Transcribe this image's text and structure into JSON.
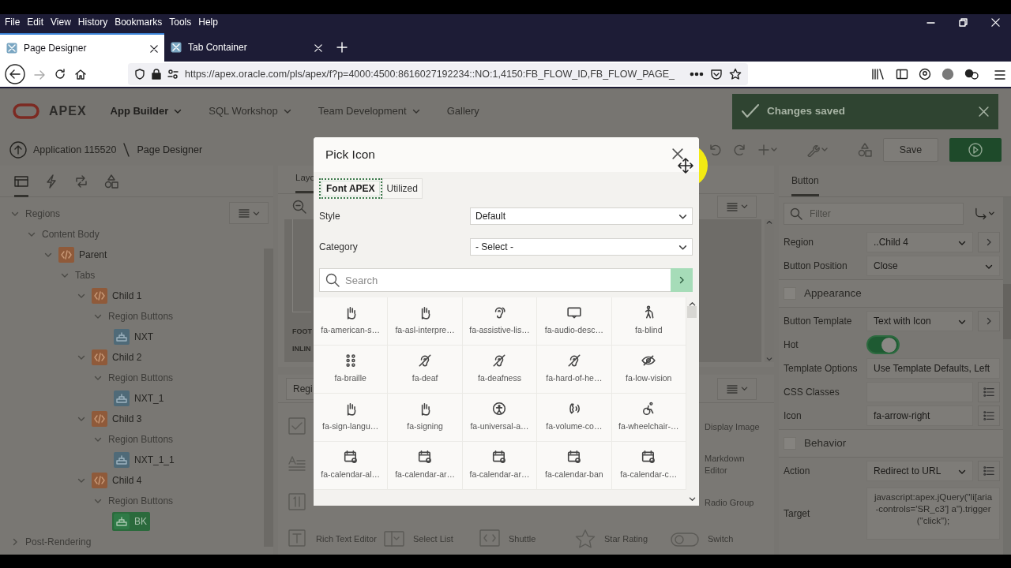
{
  "browser": {
    "menu": [
      "File",
      "Edit",
      "View",
      "History",
      "Bookmarks",
      "Tools",
      "Help"
    ],
    "tabs": [
      {
        "title": "Page Designer",
        "selected": true
      },
      {
        "title": "Tab Container",
        "selected": false
      }
    ],
    "url": "https://apex.oracle.com/pls/apex/f?p=4000:4500:8616027192234::NO:1,4150:FB_FLOW_ID,FB_FLOW_PAGE_"
  },
  "app": {
    "logo": "APEX",
    "nav": [
      {
        "label": "App Builder",
        "selected": true,
        "menu": true
      },
      {
        "label": "SQL Workshop",
        "selected": false,
        "menu": true
      },
      {
        "label": "Team Development",
        "selected": false,
        "menu": true
      },
      {
        "label": "Gallery",
        "selected": false,
        "menu": false
      }
    ],
    "toast": "Changes saved",
    "breadcrumb": [
      "Application 115520",
      "Page Designer"
    ],
    "save": "Save"
  },
  "left": {
    "tabs": [
      {
        "kind": "grid",
        "selected": true
      },
      {
        "kind": "bolt",
        "selected": false
      },
      {
        "kind": "loop",
        "selected": false
      },
      {
        "kind": "shapes",
        "selected": false
      }
    ],
    "tree": [
      {
        "label": "Regions",
        "kind": "group",
        "expanded": true,
        "selected": false,
        "children": [
          {
            "label": "Content Body",
            "kind": "group",
            "expanded": true,
            "selected": false,
            "children": [
              {
                "label": "Parent",
                "kind": "region",
                "expanded": true,
                "selected": false,
                "children": [
                  {
                    "label": "Tabs",
                    "kind": "group",
                    "expanded": true,
                    "selected": false,
                    "children": [
                      {
                        "label": "Child 1",
                        "kind": "region",
                        "expanded": true,
                        "selected": false,
                        "children": [
                          {
                            "label": "Region Buttons",
                            "kind": "group",
                            "expanded": true,
                            "selected": false,
                            "children": [
                              {
                                "label": "NXT",
                                "kind": "button",
                                "selected": false
                              }
                            ]
                          }
                        ]
                      },
                      {
                        "label": "Child 2",
                        "kind": "region",
                        "expanded": true,
                        "selected": false,
                        "children": [
                          {
                            "label": "Region Buttons",
                            "kind": "group",
                            "expanded": true,
                            "selected": false,
                            "children": [
                              {
                                "label": "NXT_1",
                                "kind": "button",
                                "selected": false
                              }
                            ]
                          }
                        ]
                      },
                      {
                        "label": "Child 3",
                        "kind": "region",
                        "expanded": true,
                        "selected": false,
                        "children": [
                          {
                            "label": "Region Buttons",
                            "kind": "group",
                            "expanded": true,
                            "selected": false,
                            "children": [
                              {
                                "label": "NXT_1_1",
                                "kind": "button",
                                "selected": false
                              }
                            ]
                          }
                        ]
                      },
                      {
                        "label": "Child 4",
                        "kind": "region",
                        "expanded": true,
                        "selected": false,
                        "children": [
                          {
                            "label": "Region Buttons",
                            "kind": "group",
                            "expanded": true,
                            "selected": false,
                            "children": [
                              {
                                "label": "BK",
                                "kind": "button",
                                "selected": true
                              }
                            ]
                          }
                        ]
                      }
                    ]
                  }
                ]
              }
            ]
          }
        ]
      },
      {
        "label": "Post-Rendering",
        "kind": "group",
        "expanded": false,
        "selected": false
      }
    ]
  },
  "center": {
    "tab": "Layo",
    "canvas_labels": [
      "FOOT",
      "INLIN"
    ],
    "gallery": {
      "tab": "Regi",
      "side_rows": [
        {
          "kind": "checkbox",
          "label": "Display Image"
        },
        {
          "kind": "textarea",
          "label": "Markdown Editor"
        },
        {
          "kind": "number",
          "label": "Radio Group"
        }
      ],
      "items": [
        {
          "kind": "text",
          "label": "Rich Text Editor"
        },
        {
          "kind": "select",
          "label": "Select List"
        },
        {
          "kind": "shuttle",
          "label": "Shuttle"
        },
        {
          "kind": "star",
          "label": "Star Rating"
        },
        {
          "kind": "switch",
          "label": "Switch"
        }
      ]
    }
  },
  "right": {
    "tab": "Button",
    "filter_placeholder": "Filter",
    "properties": [
      {
        "kind": "select",
        "label": "Region",
        "value": "..Child 4",
        "goto_button": true
      },
      {
        "kind": "select",
        "label": "Button Position",
        "value": "Close"
      },
      {
        "kind": "group",
        "label": "Appearance"
      },
      {
        "kind": "select",
        "label": "Button Template",
        "value": "Text with Icon",
        "goto_button": true
      },
      {
        "kind": "toggle",
        "label": "Hot",
        "on": true
      },
      {
        "kind": "text",
        "label": "Template Options",
        "value": "Use Template Defaults, Left"
      },
      {
        "kind": "text",
        "label": "CSS Classes",
        "list_button": true
      },
      {
        "kind": "text",
        "label": "Icon",
        "value": "fa-arrow-right",
        "list_button": true
      },
      {
        "kind": "group",
        "label": "Behavior"
      },
      {
        "kind": "select",
        "label": "Action",
        "value": "Redirect to URL",
        "list_button": true
      },
      {
        "kind": "textarea",
        "label": "Target",
        "value": "javascript:apex.jQuery(\"li[aria-controls='SR_c3'] a\").trigger(\"click\");"
      }
    ]
  },
  "dialog": {
    "title": "Pick Icon",
    "tabs": [
      {
        "label": "Font APEX",
        "selected": true
      },
      {
        "label": "Utilized",
        "selected": false
      }
    ],
    "style": {
      "label": "Style",
      "value": "Default"
    },
    "category": {
      "label": "Category",
      "value": "- Select -"
    },
    "search_placeholder": "Search",
    "icons": [
      {
        "label": "fa-american-s…"
      },
      {
        "label": "fa-asl-interpre…"
      },
      {
        "label": "fa-assistive-lis…"
      },
      {
        "label": "fa-audio-desc…"
      },
      {
        "label": "fa-blind"
      },
      {
        "label": "fa-braille"
      },
      {
        "label": "fa-deaf"
      },
      {
        "label": "fa-deafness"
      },
      {
        "label": "fa-hard-of-he…"
      },
      {
        "label": "fa-low-vision"
      },
      {
        "label": "fa-sign-langu…"
      },
      {
        "label": "fa-signing"
      },
      {
        "label": "fa-universal-a…"
      },
      {
        "label": "fa-volume-co…"
      },
      {
        "label": "fa-wheelchair-…"
      },
      {
        "label": "fa-calendar-al…"
      },
      {
        "label": "fa-calendar-ar…"
      },
      {
        "label": "fa-calendar-ar…"
      },
      {
        "label": "fa-calendar-ban"
      },
      {
        "label": "fa-calendar-c…"
      }
    ]
  }
}
